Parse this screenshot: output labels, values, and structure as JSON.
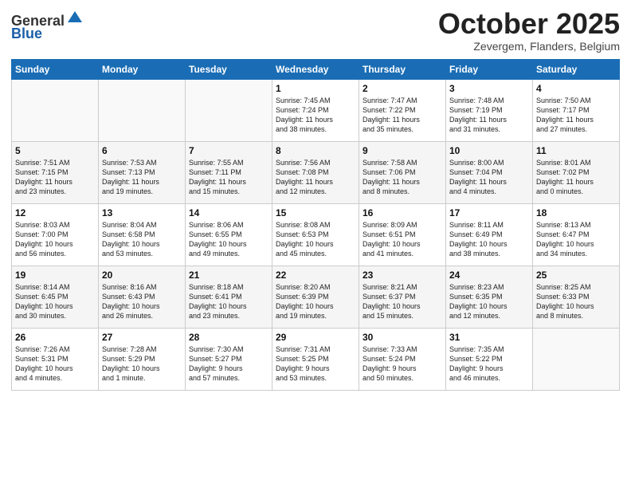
{
  "header": {
    "title": "October 2025",
    "subtitle": "Zevergem, Flanders, Belgium"
  },
  "days": [
    "Sunday",
    "Monday",
    "Tuesday",
    "Wednesday",
    "Thursday",
    "Friday",
    "Saturday"
  ],
  "weeks": [
    [
      {
        "num": "",
        "info": ""
      },
      {
        "num": "",
        "info": ""
      },
      {
        "num": "",
        "info": ""
      },
      {
        "num": "1",
        "info": "Sunrise: 7:45 AM\nSunset: 7:24 PM\nDaylight: 11 hours\nand 38 minutes."
      },
      {
        "num": "2",
        "info": "Sunrise: 7:47 AM\nSunset: 7:22 PM\nDaylight: 11 hours\nand 35 minutes."
      },
      {
        "num": "3",
        "info": "Sunrise: 7:48 AM\nSunset: 7:19 PM\nDaylight: 11 hours\nand 31 minutes."
      },
      {
        "num": "4",
        "info": "Sunrise: 7:50 AM\nSunset: 7:17 PM\nDaylight: 11 hours\nand 27 minutes."
      }
    ],
    [
      {
        "num": "5",
        "info": "Sunrise: 7:51 AM\nSunset: 7:15 PM\nDaylight: 11 hours\nand 23 minutes."
      },
      {
        "num": "6",
        "info": "Sunrise: 7:53 AM\nSunset: 7:13 PM\nDaylight: 11 hours\nand 19 minutes."
      },
      {
        "num": "7",
        "info": "Sunrise: 7:55 AM\nSunset: 7:11 PM\nDaylight: 11 hours\nand 15 minutes."
      },
      {
        "num": "8",
        "info": "Sunrise: 7:56 AM\nSunset: 7:08 PM\nDaylight: 11 hours\nand 12 minutes."
      },
      {
        "num": "9",
        "info": "Sunrise: 7:58 AM\nSunset: 7:06 PM\nDaylight: 11 hours\nand 8 minutes."
      },
      {
        "num": "10",
        "info": "Sunrise: 8:00 AM\nSunset: 7:04 PM\nDaylight: 11 hours\nand 4 minutes."
      },
      {
        "num": "11",
        "info": "Sunrise: 8:01 AM\nSunset: 7:02 PM\nDaylight: 11 hours\nand 0 minutes."
      }
    ],
    [
      {
        "num": "12",
        "info": "Sunrise: 8:03 AM\nSunset: 7:00 PM\nDaylight: 10 hours\nand 56 minutes."
      },
      {
        "num": "13",
        "info": "Sunrise: 8:04 AM\nSunset: 6:58 PM\nDaylight: 10 hours\nand 53 minutes."
      },
      {
        "num": "14",
        "info": "Sunrise: 8:06 AM\nSunset: 6:55 PM\nDaylight: 10 hours\nand 49 minutes."
      },
      {
        "num": "15",
        "info": "Sunrise: 8:08 AM\nSunset: 6:53 PM\nDaylight: 10 hours\nand 45 minutes."
      },
      {
        "num": "16",
        "info": "Sunrise: 8:09 AM\nSunset: 6:51 PM\nDaylight: 10 hours\nand 41 minutes."
      },
      {
        "num": "17",
        "info": "Sunrise: 8:11 AM\nSunset: 6:49 PM\nDaylight: 10 hours\nand 38 minutes."
      },
      {
        "num": "18",
        "info": "Sunrise: 8:13 AM\nSunset: 6:47 PM\nDaylight: 10 hours\nand 34 minutes."
      }
    ],
    [
      {
        "num": "19",
        "info": "Sunrise: 8:14 AM\nSunset: 6:45 PM\nDaylight: 10 hours\nand 30 minutes."
      },
      {
        "num": "20",
        "info": "Sunrise: 8:16 AM\nSunset: 6:43 PM\nDaylight: 10 hours\nand 26 minutes."
      },
      {
        "num": "21",
        "info": "Sunrise: 8:18 AM\nSunset: 6:41 PM\nDaylight: 10 hours\nand 23 minutes."
      },
      {
        "num": "22",
        "info": "Sunrise: 8:20 AM\nSunset: 6:39 PM\nDaylight: 10 hours\nand 19 minutes."
      },
      {
        "num": "23",
        "info": "Sunrise: 8:21 AM\nSunset: 6:37 PM\nDaylight: 10 hours\nand 15 minutes."
      },
      {
        "num": "24",
        "info": "Sunrise: 8:23 AM\nSunset: 6:35 PM\nDaylight: 10 hours\nand 12 minutes."
      },
      {
        "num": "25",
        "info": "Sunrise: 8:25 AM\nSunset: 6:33 PM\nDaylight: 10 hours\nand 8 minutes."
      }
    ],
    [
      {
        "num": "26",
        "info": "Sunrise: 7:26 AM\nSunset: 5:31 PM\nDaylight: 10 hours\nand 4 minutes."
      },
      {
        "num": "27",
        "info": "Sunrise: 7:28 AM\nSunset: 5:29 PM\nDaylight: 10 hours\nand 1 minute."
      },
      {
        "num": "28",
        "info": "Sunrise: 7:30 AM\nSunset: 5:27 PM\nDaylight: 9 hours\nand 57 minutes."
      },
      {
        "num": "29",
        "info": "Sunrise: 7:31 AM\nSunset: 5:25 PM\nDaylight: 9 hours\nand 53 minutes."
      },
      {
        "num": "30",
        "info": "Sunrise: 7:33 AM\nSunset: 5:24 PM\nDaylight: 9 hours\nand 50 minutes."
      },
      {
        "num": "31",
        "info": "Sunrise: 7:35 AM\nSunset: 5:22 PM\nDaylight: 9 hours\nand 46 minutes."
      },
      {
        "num": "",
        "info": ""
      }
    ]
  ]
}
